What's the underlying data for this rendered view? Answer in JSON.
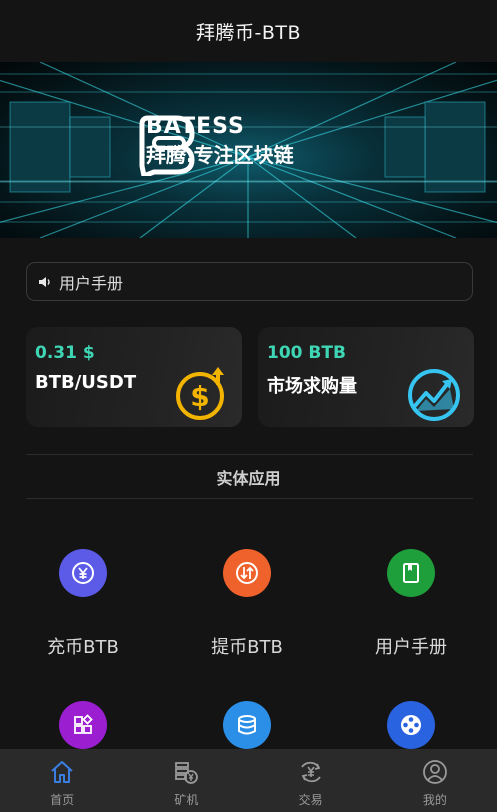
{
  "header": {
    "title": "拜腾币-BTB"
  },
  "banner": {
    "brand_name": "BATESS",
    "slogan": "拜腾.专注区块链"
  },
  "notice": {
    "icon": "speaker-icon",
    "text": "用户手册"
  },
  "cards": [
    {
      "value": "0.31 $",
      "name": "BTB/USDT",
      "icon": "dollar-coin-icon"
    },
    {
      "value": "100 BTB",
      "name": "市场求购量",
      "icon": "trend-chart-icon"
    }
  ],
  "section": {
    "title": "实体应用"
  },
  "apps": [
    {
      "label": "充币BTB",
      "icon": "yuan-exchange-icon",
      "color": "#5b5be8"
    },
    {
      "label": "提币BTB",
      "icon": "transfer-icon",
      "color": "#f0622c"
    },
    {
      "label": "用户手册",
      "icon": "book-icon",
      "color": "#1f9e3c"
    },
    {
      "label": "",
      "icon": "apps-grid-icon",
      "color": "#9b1fd1"
    },
    {
      "label": "",
      "icon": "database-icon",
      "color": "#2b8fe8"
    },
    {
      "label": "",
      "icon": "film-reel-icon",
      "color": "#2a63e0"
    }
  ],
  "tabbar": {
    "items": [
      {
        "label": "首页",
        "icon": "home-icon",
        "active": true
      },
      {
        "label": "矿机",
        "icon": "miner-icon",
        "active": false
      },
      {
        "label": "交易",
        "icon": "trade-icon",
        "active": false
      },
      {
        "label": "我的",
        "icon": "user-icon",
        "active": false
      }
    ]
  },
  "colors": {
    "accent": "#3fd6b5",
    "background": "#141414",
    "tab_active": "#3a7fe0"
  }
}
